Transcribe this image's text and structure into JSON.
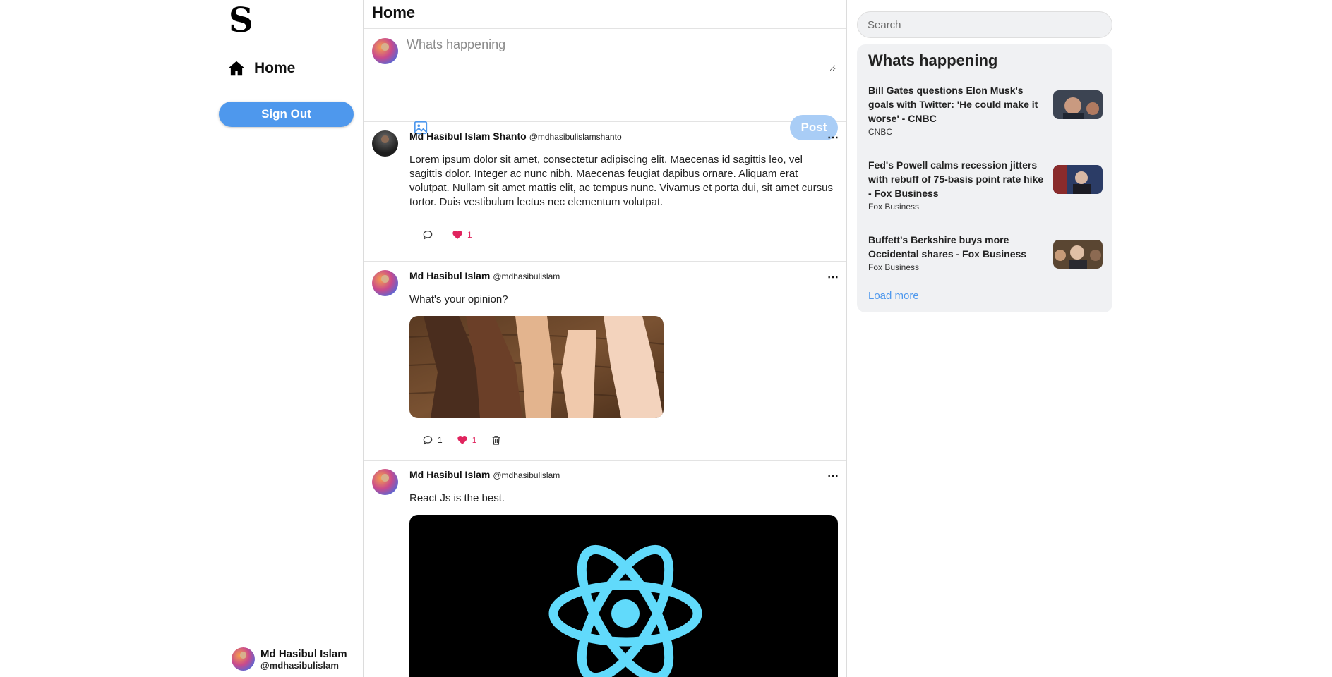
{
  "sidebar": {
    "logo": "S",
    "nav_home": "Home",
    "signout": "Sign Out",
    "profile": {
      "name": "Md Hasibul Islam",
      "handle": "@mdhasibulislam"
    }
  },
  "feed": {
    "title": "Home",
    "composer": {
      "placeholder": "Whats happening",
      "post_label": "Post"
    },
    "posts": [
      {
        "author": "Md Hasibul Islam Shanto",
        "handle": "@mdhasibulislamshanto",
        "text": "Lorem ipsum dolor sit amet, consectetur adipiscing elit. Maecenas id sagittis leo, vel sagittis dolor. Integer ac nunc nibh. Maecenas feugiat dapibus ornare. Aliquam erat volutpat. Nullam sit amet mattis elit, ac tempus nunc. Vivamus et porta dui, sit amet cursus tortor. Duis vestibulum lectus nec elementum volutpat.",
        "comments": "",
        "likes": "1"
      },
      {
        "author": "Md Hasibul Islam",
        "handle": "@mdhasibulislam",
        "text": "What's your opinion?",
        "comments": "1",
        "likes": "1"
      },
      {
        "author": "Md Hasibul Islam",
        "handle": "@mdhasibulislam",
        "text": "React Js is the best."
      }
    ]
  },
  "news": {
    "search_placeholder": "Search",
    "title": "Whats happening",
    "items": [
      {
        "title": "Bill Gates questions Elon Musk's goals with Twitter: 'He could make it worse' - CNBC",
        "source": "CNBC"
      },
      {
        "title": "Fed's Powell calms recession jitters with rebuff of 75-basis point rate hike - Fox Business",
        "source": "Fox Business"
      },
      {
        "title": "Buffett's Berkshire buys more Occidental shares - Fox Business",
        "source": "Fox Business"
      }
    ],
    "load_more": "Load more"
  },
  "colors": {
    "accent": "#4e98ed",
    "accent_disabled": "#a9cdf6",
    "like": "#e0245e",
    "panel": "#f0f1f3"
  },
  "icons": [
    "home-icon",
    "image-icon",
    "comment-icon",
    "heart-icon",
    "trash-icon",
    "more-icon",
    "react-logo-icon"
  ]
}
